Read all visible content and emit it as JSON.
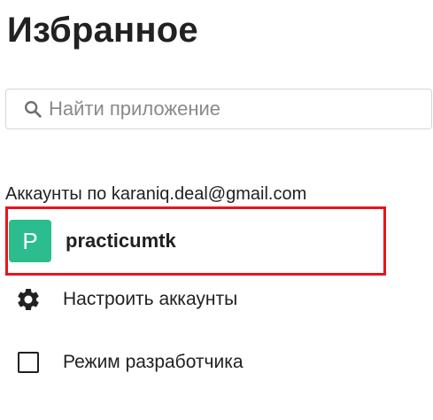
{
  "page": {
    "title": "Избранное"
  },
  "search": {
    "placeholder": "Найти приложение",
    "icon": "search-icon"
  },
  "accounts": {
    "section_label": "Аккаунты по karaniq.deal@gmail.com",
    "items": [
      {
        "avatar_letter": "P",
        "avatar_color": "#2bbd8e",
        "name": "practicumtk",
        "highlighted": true,
        "highlight_color": "#e8141c"
      }
    ]
  },
  "menu": {
    "settings_label": "Настроить аккаунты",
    "settings_icon": "gear-icon",
    "dev_mode_label": "Режим разработчика",
    "dev_mode_checked": false
  }
}
